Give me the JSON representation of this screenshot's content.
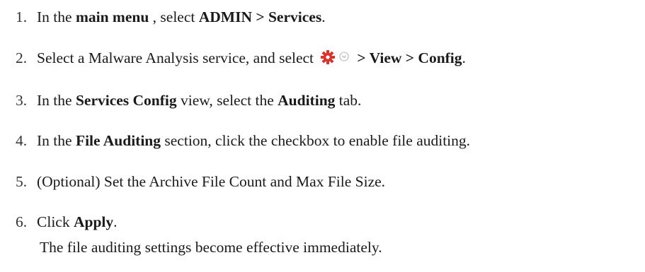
{
  "steps": [
    {
      "num": "1.",
      "parts": [
        "In the ",
        "main menu",
        " , select ",
        "ADMIN > Services",
        "."
      ]
    },
    {
      "num": "2.",
      "parts": [
        "Select a Malware Analysis service, and select ",
        "> View > Config",
        "."
      ],
      "icons": [
        "gear-icon",
        "chevron-down-circle-icon"
      ],
      "colors": {
        "gear": "#d9332b",
        "chevron": "#b8b8b8"
      }
    },
    {
      "num": "3.",
      "parts": [
        "In the ",
        "Services Config",
        " view, select the ",
        "Auditing",
        " tab."
      ]
    },
    {
      "num": "4.",
      "parts": [
        "In the ",
        "File Auditing",
        " section, click the checkbox to enable file auditing."
      ]
    },
    {
      "num": "5.",
      "parts": [
        "(Optional) Set the Archive File Count and Max File Size."
      ]
    },
    {
      "num": "6.",
      "parts": [
        "Click ",
        "Apply",
        "."
      ],
      "note": "The file auditing settings become effective immediately."
    }
  ]
}
